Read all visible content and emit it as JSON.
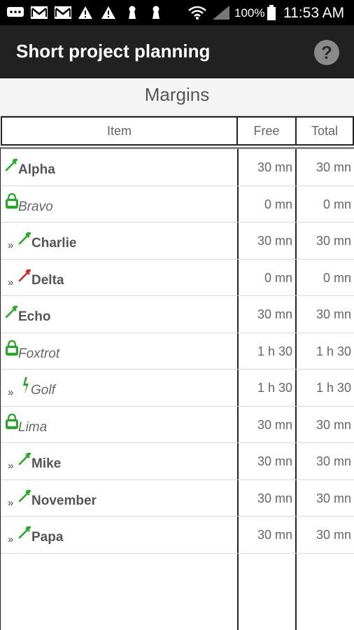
{
  "status_bar": {
    "battery_text": "100%",
    "time": "11:53 AM",
    "icons": [
      "chat-icon",
      "mail-icon",
      "mail-icon",
      "warning-icon",
      "warning-icon",
      "keyhole-icon",
      "keyhole-icon",
      "wifi-icon",
      "signal-icon",
      "battery-icon"
    ]
  },
  "app_bar": {
    "title": "Short project planning",
    "help_label": "?"
  },
  "section": {
    "title": "Margins"
  },
  "table": {
    "headers": {
      "item": "Item",
      "free": "Free",
      "total": "Total"
    },
    "rows": [
      {
        "name": "Alpha",
        "free": "30 mn",
        "total": "30 mn",
        "icon": "wrench-icon",
        "icon_color": "#22aa22",
        "indent": false,
        "style": "bold"
      },
      {
        "name": "Bravo",
        "free": "0 mn",
        "total": "0 mn",
        "icon": "bag-icon",
        "icon_color": "#22aa22",
        "indent": false,
        "style": "italic"
      },
      {
        "name": "Charlie",
        "free": "30 mn",
        "total": "30 mn",
        "icon": "wrench-icon",
        "icon_color": "#22aa22",
        "indent": true,
        "style": "bold"
      },
      {
        "name": "Delta",
        "free": "0 mn",
        "total": "0 mn",
        "icon": "wrench-icon",
        "icon_color": "#dd2222",
        "indent": true,
        "style": "bold"
      },
      {
        "name": "Echo",
        "free": "30 mn",
        "total": "30 mn",
        "icon": "wrench-icon",
        "icon_color": "#22aa22",
        "indent": false,
        "style": "bold"
      },
      {
        "name": "Foxtrot",
        "free": "1 h 30",
        "total": "1 h 30",
        "icon": "bag-icon",
        "icon_color": "#22aa22",
        "indent": false,
        "style": "italic"
      },
      {
        "name": "Golf",
        "free": "1 h 30",
        "total": "1 h 30",
        "icon": "lightning-icon",
        "icon_color": "#22aa22",
        "indent": true,
        "style": "italic"
      },
      {
        "name": "Lima",
        "free": "30 mn",
        "total": "30 mn",
        "icon": "bag-icon",
        "icon_color": "#22aa22",
        "indent": false,
        "style": "italic"
      },
      {
        "name": "Mike",
        "free": "30 mn",
        "total": "30 mn",
        "icon": "wrench-icon",
        "icon_color": "#22aa22",
        "indent": true,
        "style": "bold"
      },
      {
        "name": "November",
        "free": "30 mn",
        "total": "30 mn",
        "icon": "wrench-icon",
        "icon_color": "#22aa22",
        "indent": true,
        "style": "bold"
      },
      {
        "name": "Papa",
        "free": "30 mn",
        "total": "30 mn",
        "icon": "wrench-icon",
        "icon_color": "#22aa22",
        "indent": true,
        "style": "bold"
      }
    ],
    "indent_marker": "»"
  }
}
